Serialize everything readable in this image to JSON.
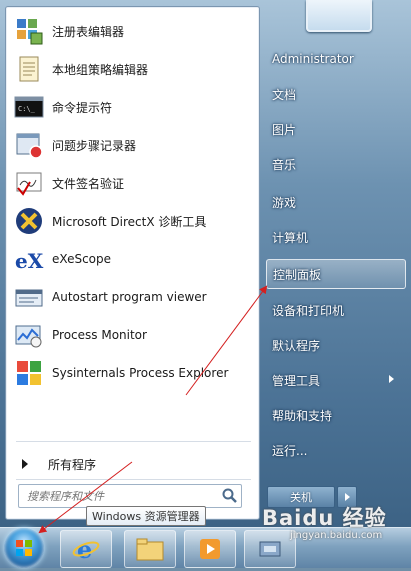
{
  "programs": [
    {
      "label": "注册表编辑器",
      "icon": "registry-editor-icon"
    },
    {
      "label": "本地组策略编辑器",
      "icon": "group-policy-icon"
    },
    {
      "label": "命令提示符",
      "icon": "command-prompt-icon"
    },
    {
      "label": "问题步骤记录器",
      "icon": "steps-recorder-icon"
    },
    {
      "label": "文件签名验证",
      "icon": "file-signature-icon"
    },
    {
      "label": "Microsoft DirectX 诊断工具",
      "icon": "directx-icon"
    },
    {
      "label": "eXeScope",
      "icon": "exescope-icon"
    },
    {
      "label": "Autostart program viewer",
      "icon": "autostart-viewer-icon"
    },
    {
      "label": "Process Monitor",
      "icon": "process-monitor-icon"
    },
    {
      "label": "Sysinternals Process Explorer",
      "icon": "process-explorer-icon"
    }
  ],
  "all_programs": "所有程序",
  "search": {
    "placeholder": "搜索程序和文件"
  },
  "right_pane": [
    {
      "label": "Administrator"
    },
    {
      "label": "文档"
    },
    {
      "label": "图片"
    },
    {
      "label": "音乐"
    },
    {
      "label": "游戏"
    },
    {
      "label": "计算机"
    },
    {
      "label": "控制面板",
      "highlight": true
    },
    {
      "label": "设备和打印机"
    },
    {
      "label": "默认程序"
    },
    {
      "label": "管理工具",
      "submenu": true
    },
    {
      "label": "帮助和支持"
    },
    {
      "label": "运行..."
    }
  ],
  "shutdown_label": "关机",
  "tooltip": "Windows 资源管理器",
  "watermark": {
    "main": "Baidu 经验",
    "sub": "jingyan.baidu.com"
  }
}
